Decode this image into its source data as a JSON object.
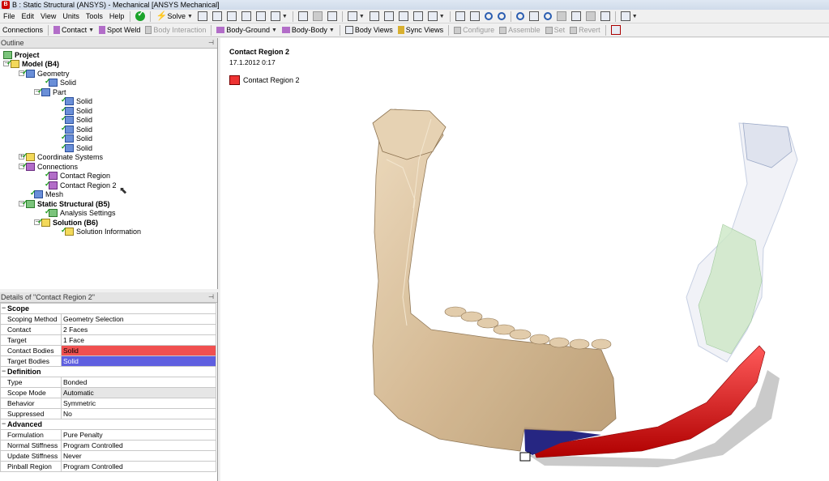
{
  "window": {
    "title": "B : Static Structural (ANSYS) - Mechanical [ANSYS Mechanical]"
  },
  "menu": [
    "File",
    "Edit",
    "View",
    "Units",
    "Tools",
    "Help"
  ],
  "toolbar": {
    "solve_label": "Solve"
  },
  "context_toolbar": {
    "connections": "Connections",
    "contact": "Contact",
    "spot_weld": "Spot Weld",
    "body_interaction": "Body Interaction",
    "body_ground": "Body-Ground",
    "body_body": "Body-Body",
    "body_views": "Body Views",
    "sync_views": "Sync Views",
    "configure": "Configure",
    "assemble": "Assemble",
    "set": "Set",
    "revert": "Revert"
  },
  "outline": {
    "header": "Outline",
    "tree": [
      {
        "label": "Project",
        "bold": true
      },
      {
        "label": "Model (B4)",
        "bold": true
      },
      {
        "label": "Geometry"
      },
      {
        "label": "Solid"
      },
      {
        "label": "Part"
      },
      {
        "label": "Solid"
      },
      {
        "label": "Solid"
      },
      {
        "label": "Solid"
      },
      {
        "label": "Solid"
      },
      {
        "label": "Solid"
      },
      {
        "label": "Solid"
      },
      {
        "label": "Coordinate Systems"
      },
      {
        "label": "Connections"
      },
      {
        "label": "Contact Region"
      },
      {
        "label": "Contact Region 2"
      },
      {
        "label": "Mesh"
      },
      {
        "label": "Static Structural (B5)",
        "bold": true
      },
      {
        "label": "Analysis Settings"
      },
      {
        "label": "Solution (B6)",
        "bold": true
      },
      {
        "label": "Solution Information"
      }
    ]
  },
  "details": {
    "header": "Details of \"Contact Region 2\"",
    "sections": [
      {
        "name": "Scope",
        "rows": [
          {
            "key": "Scoping Method",
            "value": "Geometry Selection"
          },
          {
            "key": "Contact",
            "value": "2 Faces"
          },
          {
            "key": "Target",
            "value": "1 Face"
          },
          {
            "key": "Contact Bodies",
            "value": "Solid"
          },
          {
            "key": "Target Bodies",
            "value": "Solid"
          }
        ]
      },
      {
        "name": "Definition",
        "rows": [
          {
            "key": "Type",
            "value": "Bonded"
          },
          {
            "key": "Scope Mode",
            "value": "Automatic"
          },
          {
            "key": "Behavior",
            "value": "Symmetric"
          },
          {
            "key": "Suppressed",
            "value": "No"
          }
        ]
      },
      {
        "name": "Advanced",
        "rows": [
          {
            "key": "Formulation",
            "value": "Pure Penalty"
          },
          {
            "key": "Normal Stiffness",
            "value": "Program Controlled"
          },
          {
            "key": "Update Stiffness",
            "value": "Never"
          },
          {
            "key": "Pinball Region",
            "value": "Program Controlled"
          }
        ]
      }
    ]
  },
  "viewport": {
    "title": "Contact Region 2",
    "date": "17.1.2012 0:17",
    "legend_label": "Contact Region 2",
    "colors": {
      "contact": "#e02020",
      "target": "#2a2a9a",
      "bone": "#d9c2a0"
    }
  }
}
